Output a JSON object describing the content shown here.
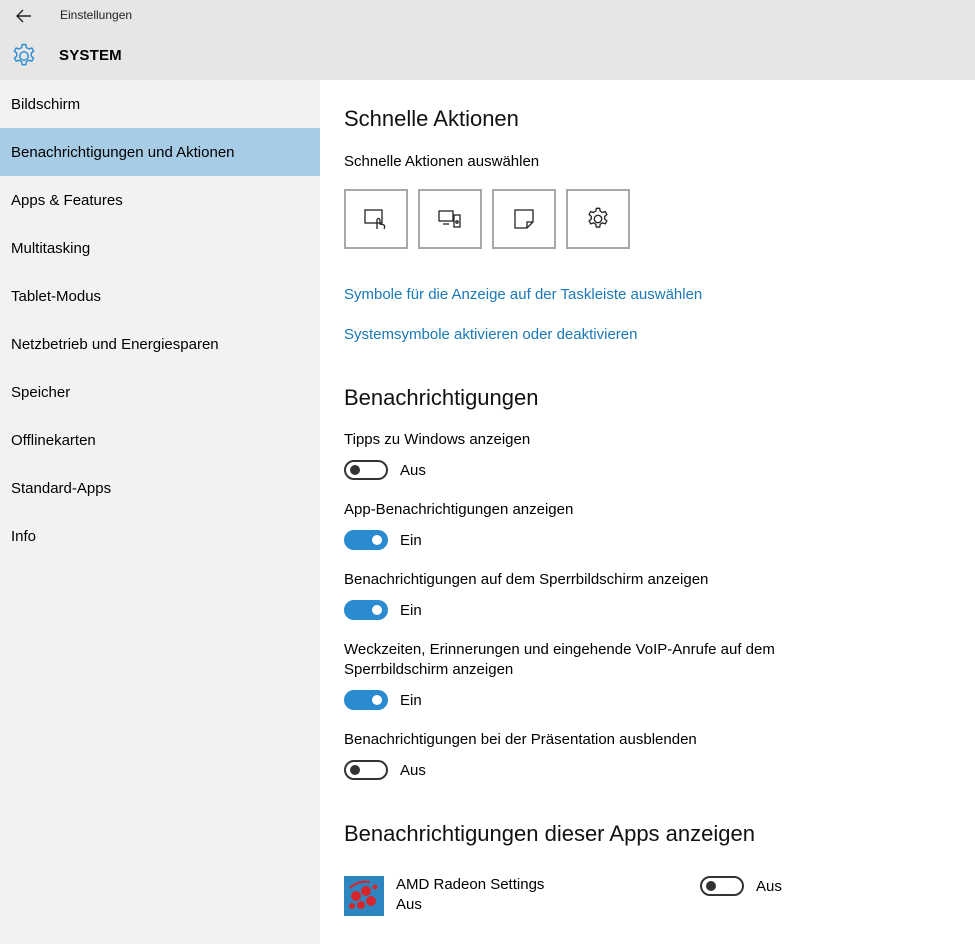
{
  "header": {
    "app_title": "Einstellungen",
    "section_title": "SYSTEM"
  },
  "sidebar": {
    "items": [
      {
        "label": "Bildschirm",
        "selected": false
      },
      {
        "label": "Benachrichtigungen und Aktionen",
        "selected": true
      },
      {
        "label": "Apps & Features",
        "selected": false
      },
      {
        "label": "Multitasking",
        "selected": false
      },
      {
        "label": "Tablet-Modus",
        "selected": false
      },
      {
        "label": "Netzbetrieb und Energiesparen",
        "selected": false
      },
      {
        "label": "Speicher",
        "selected": false
      },
      {
        "label": "Offlinekarten",
        "selected": false
      },
      {
        "label": "Standard-Apps",
        "selected": false
      },
      {
        "label": "Info",
        "selected": false
      }
    ]
  },
  "quick_actions": {
    "heading": "Schnelle Aktionen",
    "subheading": "Schnelle Aktionen auswählen",
    "buttons": [
      {
        "icon": "tablet-mode-icon"
      },
      {
        "icon": "project-icon"
      },
      {
        "icon": "note-icon"
      },
      {
        "icon": "settings-gear-icon"
      }
    ],
    "link_taskbar": "Symbole für die Anzeige auf der Taskleiste auswählen",
    "link_system_icons": "Systemsymbole aktivieren oder deaktivieren"
  },
  "notifications": {
    "heading": "Benachrichtigungen",
    "settings": [
      {
        "label": "Tipps zu Windows anzeigen",
        "state": "Aus",
        "on": false
      },
      {
        "label": "App-Benachrichtigungen anzeigen",
        "state": "Ein",
        "on": true
      },
      {
        "label": "Benachrichtigungen auf dem Sperrbildschirm anzeigen",
        "state": "Ein",
        "on": true
      },
      {
        "label_line1": "Weckzeiten, Erinnerungen und eingehende VoIP-Anrufe auf dem",
        "label_line2": "Sperrbildschirm anzeigen",
        "state": "Ein",
        "on": true
      },
      {
        "label": "Benachrichtigungen bei der Präsentation ausblenden",
        "state": "Aus",
        "on": false
      }
    ]
  },
  "apps": {
    "heading": "Benachrichtigungen dieser Apps anzeigen",
    "items": [
      {
        "name": "AMD Radeon Settings",
        "sub": "Aus",
        "state": "Aus",
        "on": false
      }
    ]
  },
  "colors": {
    "accent": "#2b8bd0",
    "selected_nav": "#a7cde6",
    "link": "#1a79b8"
  }
}
